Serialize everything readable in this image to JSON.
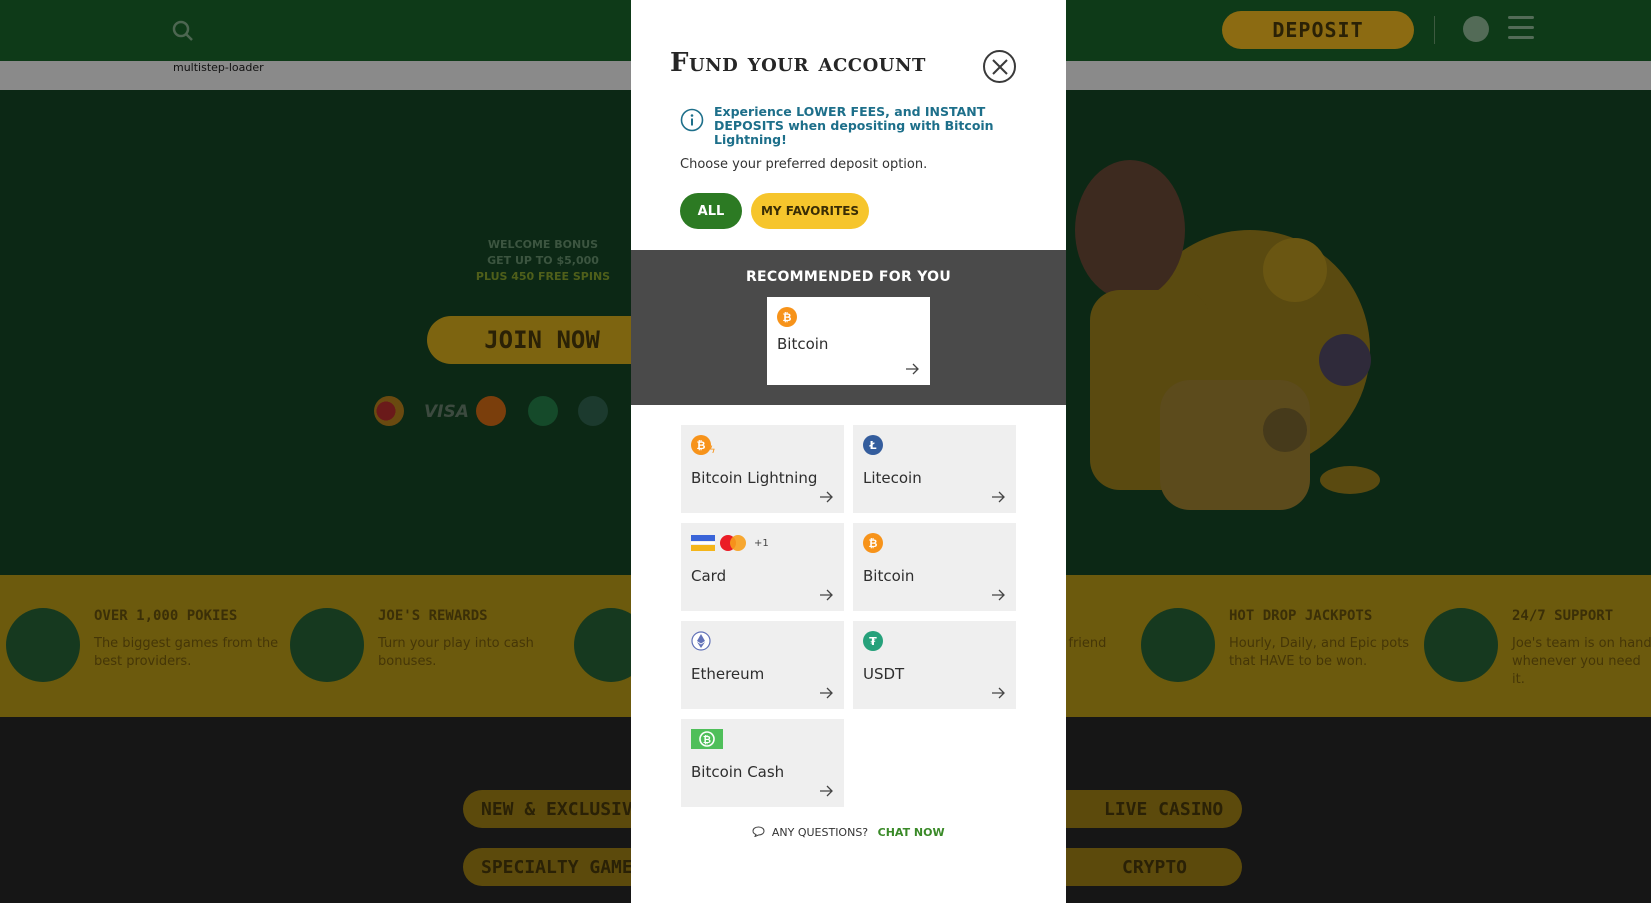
{
  "background": {
    "loader_text": "multistep-loader",
    "deposit_label": "DEPOSIT",
    "promo": {
      "line1": "WELCOME BONUS",
      "line2": "GET UP TO $5,000",
      "line3": "PLUS 450 FREE SPINS"
    },
    "join_label": "JOIN NOW",
    "visa_label": "VISA",
    "features": [
      {
        "title": "OVER 1,000 POKIES",
        "desc": "The biggest games from the best providers."
      },
      {
        "title": "JOE'S REWARDS",
        "desc": "Turn your play into cash bonuses."
      },
      {
        "title": "",
        "desc": "h friend"
      },
      {
        "title": "HOT DROP JACKPOTS",
        "desc": "Hourly, Daily, and Epic pots that HAVE to be won."
      },
      {
        "title": "24/7 SUPPORT",
        "desc": "Joe's team is on hand whenever you need it."
      }
    ],
    "categories": [
      "NEW & EXCLUSIVE",
      "LIVE CASINO",
      "SPECIALTY GAMES",
      "CRYPTO"
    ]
  },
  "modal": {
    "title": "Fund your account",
    "info": "Experience LOWER FEES, and INSTANT DEPOSITS when depositing with Bitcoin Lightning!",
    "choose": "Choose your preferred deposit option.",
    "filters": {
      "all": "ALL",
      "favorites": "MY FAVORITES"
    },
    "recommended_title": "RECOMMENDED FOR YOU",
    "recommended": {
      "label": "Bitcoin",
      "icon": "bitcoin-icon"
    },
    "methods": [
      {
        "label": "Bitcoin Lightning",
        "icon": "bitcoin-lightning-icon"
      },
      {
        "label": "Litecoin",
        "icon": "litecoin-icon"
      },
      {
        "label": "Card",
        "icon": "card-icons",
        "extra": "+1"
      },
      {
        "label": "Bitcoin",
        "icon": "bitcoin-icon"
      },
      {
        "label": "Ethereum",
        "icon": "ethereum-icon"
      },
      {
        "label": "USDT",
        "icon": "usdt-icon"
      },
      {
        "label": "Bitcoin Cash",
        "icon": "bitcoin-cash-icon"
      }
    ],
    "questions": "ANY QUESTIONS?",
    "chat": "CHAT NOW"
  },
  "colors": {
    "accent_green": "#2c7a23",
    "accent_yellow": "#f6c52c",
    "info_blue": "#1d6f8a",
    "bitcoin_orange": "#f7931a",
    "litecoin_blue": "#345d9d",
    "usdt_green": "#26a17b",
    "bch_green": "#4fbf5a"
  }
}
